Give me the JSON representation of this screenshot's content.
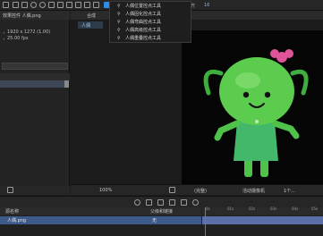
{
  "toolbar": {
    "snap_label": "对齐",
    "number_label": "16"
  },
  "project_panel": {
    "title": "项目",
    "tab_label": "效果控件 人偶.png",
    "info_line1": "，1920 x 1272 (1.00)",
    "info_line2": "，25.00 fps"
  },
  "composition_panel": {
    "tab_label": "合成",
    "inner_tab": "人偶"
  },
  "tool_menu": {
    "items": [
      {
        "label": "人偶位置控点工具",
        "icon": "pin-icon",
        "selected": true
      },
      {
        "label": "人偶固化控点工具",
        "icon": "starch-icon",
        "selected": false
      },
      {
        "label": "人偶弯曲控点工具",
        "icon": "bend-icon",
        "selected": false
      },
      {
        "label": "人偶高级控点工具",
        "icon": "advanced-icon",
        "selected": false
      },
      {
        "label": "人偶重叠控点工具",
        "icon": "overlap-icon",
        "selected": false
      }
    ]
  },
  "viewer_footer": {
    "zoom": "100%",
    "quality": "(完整)",
    "camera": "活动摄像机",
    "views": "1个..."
  },
  "timeline": {
    "header_source": "源名称",
    "header_parent": "父级和链接",
    "layer_name": "人偶.png",
    "parent_value": "无",
    "ticks": [
      "0s",
      "01s",
      "02s",
      "03s",
      "04s",
      "05s"
    ]
  },
  "colors": {
    "accent": "#2d8ceb",
    "character_green": "#4fc24a",
    "bow_pink": "#e0559a",
    "timeline_layer": "#3c5a8a"
  }
}
